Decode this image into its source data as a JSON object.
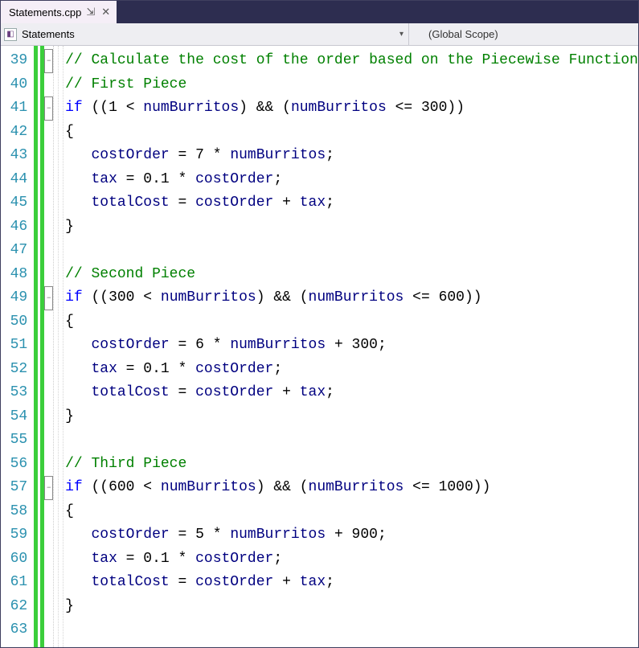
{
  "tab": {
    "filename": "Statements.cpp",
    "pin": "⇲",
    "close": "✕"
  },
  "navbar": {
    "left": "Statements",
    "scope": "(Global Scope)"
  },
  "startLine": 39,
  "foldLines": [
    39,
    41,
    49,
    57
  ],
  "code": [
    [
      [
        "c",
        "// Calculate the cost of the order based on the Piecewise Function"
      ]
    ],
    [
      [
        "c",
        "// First Piece"
      ]
    ],
    [
      [
        "k",
        "if"
      ],
      [
        "op",
        " (("
      ],
      [
        "n",
        "1"
      ],
      [
        "op",
        " < "
      ],
      [
        "id",
        "numBurritos"
      ],
      [
        "op",
        ") && ("
      ],
      [
        "id",
        "numBurritos"
      ],
      [
        "op",
        " <= "
      ],
      [
        "n",
        "300"
      ],
      [
        "op",
        "))"
      ]
    ],
    [
      [
        "op",
        "{"
      ]
    ],
    [
      [
        "op",
        "   "
      ],
      [
        "id",
        "costOrder"
      ],
      [
        "op",
        " = "
      ],
      [
        "n",
        "7"
      ],
      [
        "op",
        " * "
      ],
      [
        "id",
        "numBurritos"
      ],
      [
        "op",
        ";"
      ]
    ],
    [
      [
        "op",
        "   "
      ],
      [
        "id",
        "tax"
      ],
      [
        "op",
        " = "
      ],
      [
        "n",
        "0.1"
      ],
      [
        "op",
        " * "
      ],
      [
        "id",
        "costOrder"
      ],
      [
        "op",
        ";"
      ]
    ],
    [
      [
        "op",
        "   "
      ],
      [
        "id",
        "totalCost"
      ],
      [
        "op",
        " = "
      ],
      [
        "id",
        "costOrder"
      ],
      [
        "op",
        " + "
      ],
      [
        "id",
        "tax"
      ],
      [
        "op",
        ";"
      ]
    ],
    [
      [
        "op",
        "}"
      ]
    ],
    [],
    [
      [
        "c",
        "// Second Piece"
      ]
    ],
    [
      [
        "k",
        "if"
      ],
      [
        "op",
        " (("
      ],
      [
        "n",
        "300"
      ],
      [
        "op",
        " < "
      ],
      [
        "id",
        "numBurritos"
      ],
      [
        "op",
        ") && ("
      ],
      [
        "id",
        "numBurritos"
      ],
      [
        "op",
        " <= "
      ],
      [
        "n",
        "600"
      ],
      [
        "op",
        "))"
      ]
    ],
    [
      [
        "op",
        "{"
      ]
    ],
    [
      [
        "op",
        "   "
      ],
      [
        "id",
        "costOrder"
      ],
      [
        "op",
        " = "
      ],
      [
        "n",
        "6"
      ],
      [
        "op",
        " * "
      ],
      [
        "id",
        "numBurritos"
      ],
      [
        "op",
        " + "
      ],
      [
        "n",
        "300"
      ],
      [
        "op",
        ";"
      ]
    ],
    [
      [
        "op",
        "   "
      ],
      [
        "id",
        "tax"
      ],
      [
        "op",
        " = "
      ],
      [
        "n",
        "0.1"
      ],
      [
        "op",
        " * "
      ],
      [
        "id",
        "costOrder"
      ],
      [
        "op",
        ";"
      ]
    ],
    [
      [
        "op",
        "   "
      ],
      [
        "id",
        "totalCost"
      ],
      [
        "op",
        " = "
      ],
      [
        "id",
        "costOrder"
      ],
      [
        "op",
        " + "
      ],
      [
        "id",
        "tax"
      ],
      [
        "op",
        ";"
      ]
    ],
    [
      [
        "op",
        "}"
      ]
    ],
    [],
    [
      [
        "c",
        "// Third Piece"
      ]
    ],
    [
      [
        "k",
        "if"
      ],
      [
        "op",
        " (("
      ],
      [
        "n",
        "600"
      ],
      [
        "op",
        " < "
      ],
      [
        "id",
        "numBurritos"
      ],
      [
        "op",
        ") && ("
      ],
      [
        "id",
        "numBurritos"
      ],
      [
        "op",
        " <= "
      ],
      [
        "n",
        "1000"
      ],
      [
        "op",
        "))"
      ]
    ],
    [
      [
        "op",
        "{"
      ]
    ],
    [
      [
        "op",
        "   "
      ],
      [
        "id",
        "costOrder"
      ],
      [
        "op",
        " = "
      ],
      [
        "n",
        "5"
      ],
      [
        "op",
        " * "
      ],
      [
        "id",
        "numBurritos"
      ],
      [
        "op",
        " + "
      ],
      [
        "n",
        "900"
      ],
      [
        "op",
        ";"
      ]
    ],
    [
      [
        "op",
        "   "
      ],
      [
        "id",
        "tax"
      ],
      [
        "op",
        " = "
      ],
      [
        "n",
        "0.1"
      ],
      [
        "op",
        " * "
      ],
      [
        "id",
        "costOrder"
      ],
      [
        "op",
        ";"
      ]
    ],
    [
      [
        "op",
        "   "
      ],
      [
        "id",
        "totalCost"
      ],
      [
        "op",
        " = "
      ],
      [
        "id",
        "costOrder"
      ],
      [
        "op",
        " + "
      ],
      [
        "id",
        "tax"
      ],
      [
        "op",
        ";"
      ]
    ],
    [
      [
        "op",
        "}"
      ]
    ],
    []
  ]
}
